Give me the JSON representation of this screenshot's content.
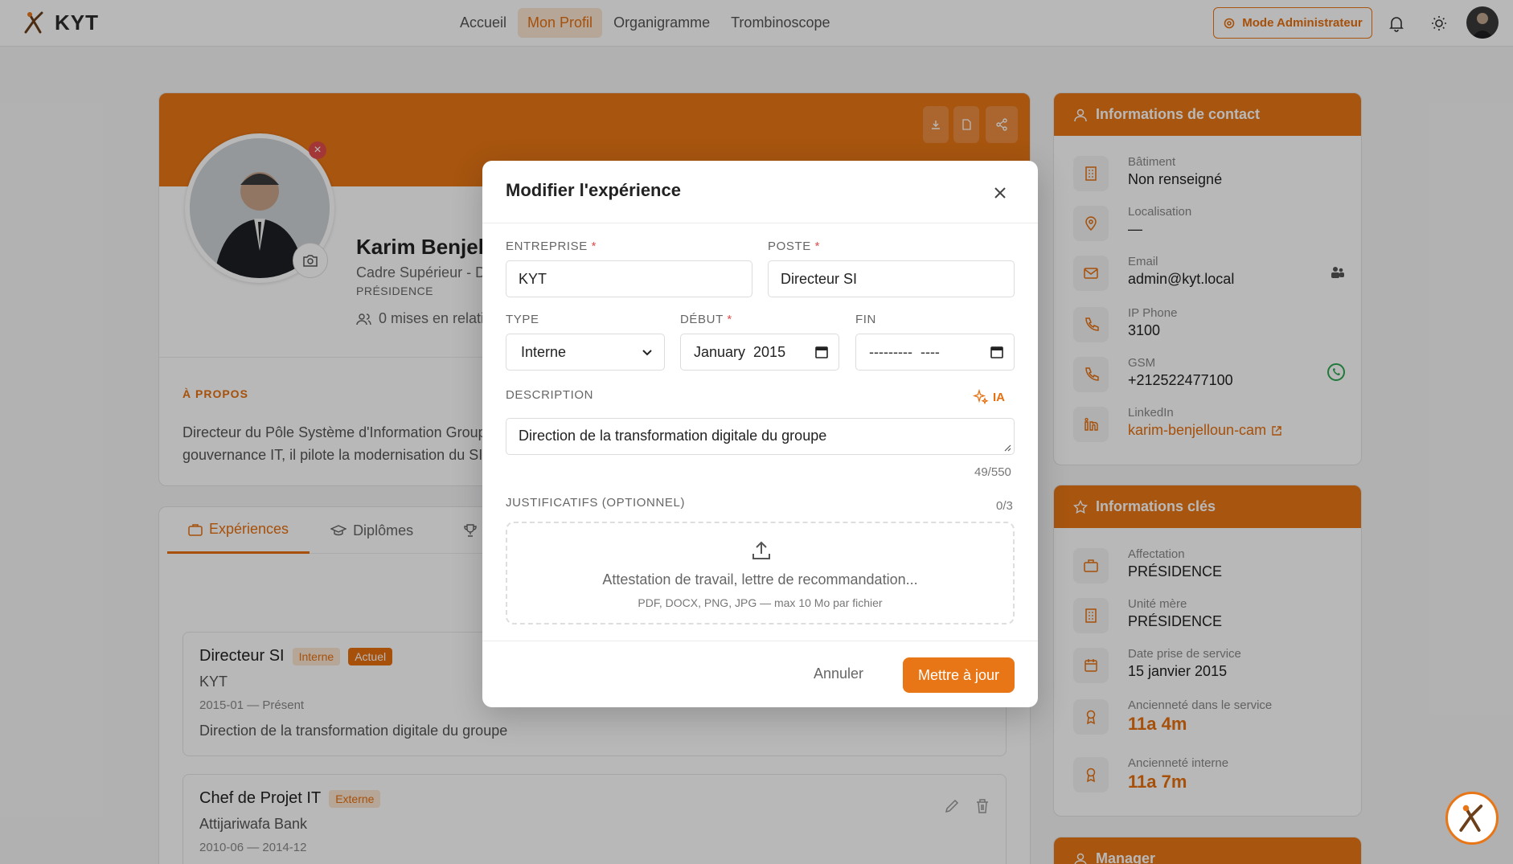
{
  "app": {
    "name": "KYT"
  },
  "nav": {
    "links": [
      "Accueil",
      "Mon Profil",
      "Organigramme",
      "Trombinoscope"
    ],
    "admin_label": "Mode Administrateur"
  },
  "profile": {
    "name": "Karim Benjell",
    "role": "Cadre Supérieur - D",
    "dept": "PRÉSIDENCE",
    "relations": "0 mises en relati",
    "about_title": "À PROPOS",
    "about_line1": "Directeur du Pôle Système d'Information Group",
    "about_line2": "gouvernance IT, il pilote la modernisation du SI"
  },
  "tabs": [
    "Expériences",
    "Diplômes"
  ],
  "experiences": [
    {
      "title": "Directeur SI",
      "type": "Interne",
      "current": "Actuel",
      "company": "KYT",
      "dates": "2015-01 — Présent",
      "desc": "Direction de la transformation digitale du groupe"
    },
    {
      "title": "Chef de Projet IT",
      "type": "Externe",
      "company": "Attijariwafa Bank",
      "dates": "2010-06 — 2014-12"
    }
  ],
  "contact": {
    "title": "Informations de contact",
    "rows": [
      {
        "label": "Bâtiment",
        "value": "Non renseigné"
      },
      {
        "label": "Localisation",
        "value": "—"
      },
      {
        "label": "Email",
        "value": "admin@kyt.local"
      },
      {
        "label": "IP Phone",
        "value": "3100"
      },
      {
        "label": "GSM",
        "value": "+212522477100"
      },
      {
        "label": "LinkedIn",
        "value": "karim-benjelloun-cam"
      }
    ]
  },
  "keyinfo": {
    "title": "Informations clés",
    "rows": [
      {
        "label": "Affectation",
        "value": "PRÉSIDENCE"
      },
      {
        "label": "Unité mère",
        "value": "PRÉSIDENCE"
      },
      {
        "label": "Date prise de service",
        "value": "15 janvier 2015"
      },
      {
        "label": "Ancienneté dans le service",
        "value": "11a 4m"
      },
      {
        "label": "Ancienneté interne",
        "value": "11a 7m"
      }
    ]
  },
  "manager": {
    "title": "Manager"
  },
  "modal": {
    "title": "Modifier l'expérience",
    "entreprise_label": "ENTREPRISE",
    "entreprise_value": "KYT",
    "poste_label": "POSTE",
    "poste_value": "Directeur SI",
    "type_label": "TYPE",
    "type_value": "Interne",
    "debut_label": "DÉBUT",
    "debut_value": "January  2015",
    "fin_label": "FIN",
    "fin_value": "---------  ----",
    "description_label": "DESCRIPTION",
    "ia_label": "IA",
    "description_value": "Direction de la transformation digitale du groupe",
    "char_count": "49/550",
    "justif_label": "JUSTIFICATIFS (OPTIONNEL)",
    "justif_count": "0/3",
    "drop_main": "Attestation de travail, lettre de recommandation...",
    "drop_sub": "PDF, DOCX, PNG, JPG — max 10 Mo par fichier",
    "cancel": "Annuler",
    "submit": "Mettre à jour"
  },
  "colors": {
    "accent": "#e87616",
    "accent_light": "#fbe6d3",
    "danger": "#e24c4c"
  }
}
